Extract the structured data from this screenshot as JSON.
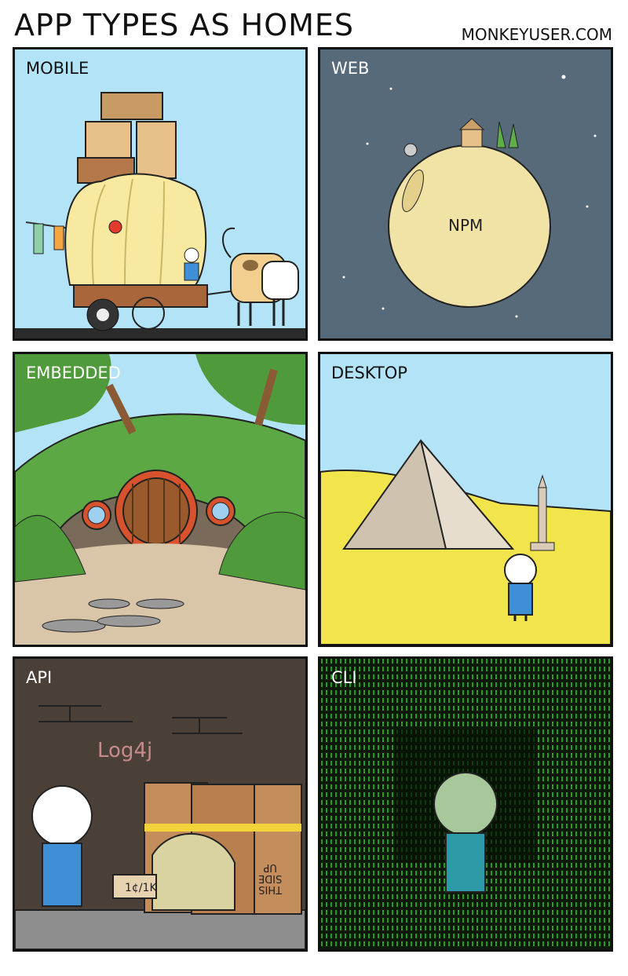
{
  "header": {
    "title": "APP TYPES AS HOMES",
    "site": "MONKEYUSER.COM"
  },
  "panels": [
    {
      "label": "MOBILE"
    },
    {
      "label": "WEB",
      "planet_text": "NPM"
    },
    {
      "label": "EMBEDDED"
    },
    {
      "label": "DESKTOP"
    },
    {
      "label": "API",
      "sign_text": "1¢/1K",
      "box_text_1": "THIS",
      "box_text_2": "SIDE",
      "box_text_3": "UP"
    },
    {
      "label": "CLI"
    }
  ]
}
